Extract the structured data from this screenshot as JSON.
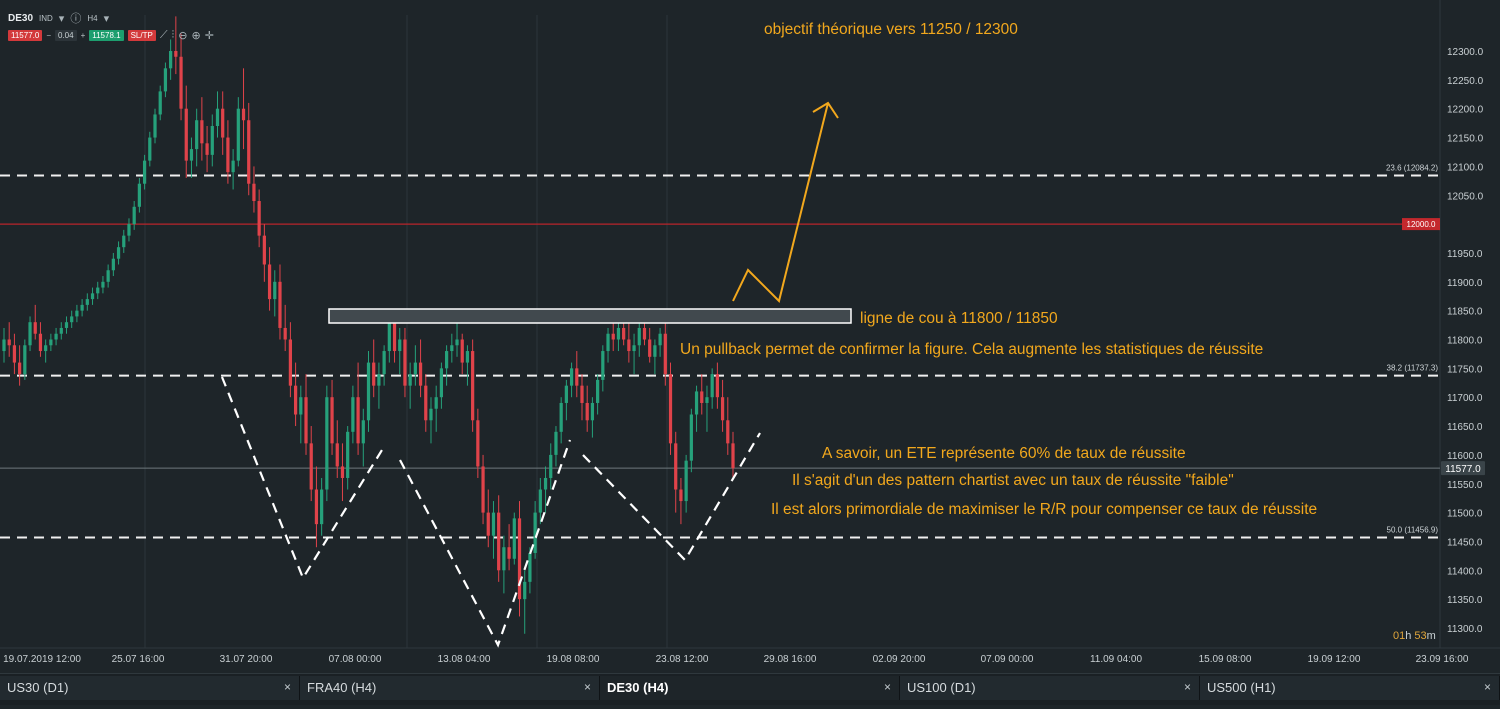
{
  "toolbar": {
    "symbol": "DE30",
    "type_badge": "IND",
    "timeframe": "H4",
    "bid_price": "11577.0",
    "minus": "−",
    "lot_size": "0.04",
    "plus": "+",
    "ask_price": "11578.1",
    "sltp_label": "SL/TP"
  },
  "chart_data": {
    "type": "candlestick",
    "instrument": "DE30 (H4)",
    "ylim": [
      11250,
      12370
    ],
    "y_ticks": [
      "12300.0",
      "12250.0",
      "12200.0",
      "12150.0",
      "12100.0",
      "12050.0",
      "12000.0",
      "11950.0",
      "11900.0",
      "11850.0",
      "11800.0",
      "11750.0",
      "11700.0",
      "11650.0",
      "11600.0",
      "11550.0",
      "11500.0",
      "11450.0",
      "11400.0",
      "11350.0",
      "11300.0"
    ],
    "x_ticks": [
      "19.07.2019 12:00",
      "25.07 16:00",
      "31.07 20:00",
      "07.08 00:00",
      "13.08 04:00",
      "19.08 08:00",
      "23.08 12:00",
      "29.08 16:00",
      "02.09 20:00",
      "07.09 00:00",
      "11.09 04:00",
      "15.09 08:00",
      "19.09 12:00",
      "23.09 16:00"
    ],
    "current_price": "11577.0",
    "level_12000": "12000.0",
    "fib_levels": [
      {
        "label": "23.6 (12084.2)",
        "value": 12084.2
      },
      {
        "label": "38.2 (11737.3)",
        "value": 11737.3
      },
      {
        "label": "50.0 (11456.9)",
        "value": 11456.9
      }
    ],
    "countdown": {
      "hours": "01",
      "h": "h",
      "minutes": "53",
      "m": "m"
    },
    "colors": {
      "up": "#26a17b",
      "down": "#e0434a",
      "annotation": "#f2a81d",
      "red_line": "#b8252a"
    },
    "annotations": [
      "objectif théorique vers 11250 / 12300",
      "ligne de cou à 11800 / 11850",
      "Un pullback permet de confirmer la figure. Cela augmente les statistiques de réussite",
      "A savoir, un ETE représente 60% de taux de réussite",
      "Il s'agit d'un des pattern chartist avec un taux de réussite \"faible\"",
      "Il est alors primordiale de maximiser le R/R pour compenser ce taux de réussite"
    ],
    "candles": [
      [
        11780,
        11820,
        11760,
        11800
      ],
      [
        11800,
        11830,
        11770,
        11790
      ],
      [
        11790,
        11810,
        11740,
        11760
      ],
      [
        11760,
        11790,
        11720,
        11740
      ],
      [
        11740,
        11800,
        11730,
        11790
      ],
      [
        11790,
        11840,
        11780,
        11830
      ],
      [
        11830,
        11860,
        11800,
        11810
      ],
      [
        11810,
        11830,
        11770,
        11780
      ],
      [
        11780,
        11800,
        11760,
        11790
      ],
      [
        11790,
        11810,
        11780,
        11800
      ],
      [
        11800,
        11820,
        11790,
        11810
      ],
      [
        11810,
        11830,
        11800,
        11820
      ],
      [
        11820,
        11840,
        11810,
        11830
      ],
      [
        11830,
        11850,
        11820,
        11840
      ],
      [
        11840,
        11860,
        11830,
        11850
      ],
      [
        11850,
        11870,
        11840,
        11860
      ],
      [
        11860,
        11880,
        11850,
        11870
      ],
      [
        11870,
        11890,
        11860,
        11880
      ],
      [
        11880,
        11900,
        11870,
        11890
      ],
      [
        11890,
        11910,
        11880,
        11900
      ],
      [
        11900,
        11930,
        11890,
        11920
      ],
      [
        11920,
        11950,
        11910,
        11940
      ],
      [
        11940,
        11970,
        11930,
        11960
      ],
      [
        11960,
        11990,
        11950,
        11980
      ],
      [
        11980,
        12010,
        11970,
        12000
      ],
      [
        12000,
        12040,
        11990,
        12030
      ],
      [
        12030,
        12080,
        12020,
        12070
      ],
      [
        12070,
        12120,
        12060,
        12110
      ],
      [
        12110,
        12160,
        12100,
        12150
      ],
      [
        12150,
        12200,
        12140,
        12190
      ],
      [
        12190,
        12240,
        12180,
        12230
      ],
      [
        12230,
        12280,
        12220,
        12270
      ],
      [
        12270,
        12320,
        12250,
        12300
      ],
      [
        12300,
        12360,
        12260,
        12290
      ],
      [
        12290,
        12330,
        12180,
        12200
      ],
      [
        12200,
        12240,
        12080,
        12110
      ],
      [
        12110,
        12150,
        12080,
        12130
      ],
      [
        12130,
        12200,
        12100,
        12180
      ],
      [
        12180,
        12220,
        12110,
        12140
      ],
      [
        12140,
        12170,
        12090,
        12120
      ],
      [
        12120,
        12190,
        12100,
        12170
      ],
      [
        12170,
        12230,
        12150,
        12200
      ],
      [
        12200,
        12230,
        12120,
        12150
      ],
      [
        12150,
        12180,
        12070,
        12090
      ],
      [
        12090,
        12130,
        12060,
        12110
      ],
      [
        12110,
        12220,
        12100,
        12200
      ],
      [
        12200,
        12270,
        12130,
        12180
      ],
      [
        12180,
        12210,
        12050,
        12070
      ],
      [
        12070,
        12100,
        12020,
        12040
      ],
      [
        12040,
        12060,
        11960,
        11980
      ],
      [
        11980,
        12000,
        11900,
        11930
      ],
      [
        11930,
        11960,
        11850,
        11870
      ],
      [
        11870,
        11920,
        11840,
        11900
      ],
      [
        11900,
        11930,
        11800,
        11820
      ],
      [
        11820,
        11860,
        11780,
        11800
      ],
      [
        11800,
        11830,
        11700,
        11720
      ],
      [
        11720,
        11760,
        11650,
        11670
      ],
      [
        11670,
        11720,
        11620,
        11700
      ],
      [
        11700,
        11740,
        11600,
        11620
      ],
      [
        11620,
        11650,
        11520,
        11540
      ],
      [
        11540,
        11580,
        11440,
        11480
      ],
      [
        11480,
        11560,
        11460,
        11540
      ],
      [
        11540,
        11720,
        11520,
        11700
      ],
      [
        11700,
        11730,
        11600,
        11620
      ],
      [
        11620,
        11660,
        11560,
        11580
      ],
      [
        11580,
        11620,
        11520,
        11560
      ],
      [
        11560,
        11650,
        11540,
        11640
      ],
      [
        11640,
        11720,
        11620,
        11700
      ],
      [
        11700,
        11760,
        11600,
        11620
      ],
      [
        11620,
        11680,
        11580,
        11660
      ],
      [
        11660,
        11780,
        11640,
        11760
      ],
      [
        11760,
        11800,
        11700,
        11720
      ],
      [
        11720,
        11760,
        11680,
        11740
      ],
      [
        11740,
        11790,
        11720,
        11780
      ],
      [
        11780,
        11850,
        11760,
        11830
      ],
      [
        11830,
        11840,
        11760,
        11780
      ],
      [
        11780,
        11820,
        11740,
        11800
      ],
      [
        11800,
        11820,
        11700,
        11720
      ],
      [
        11720,
        11760,
        11680,
        11740
      ],
      [
        11740,
        11790,
        11720,
        11760
      ],
      [
        11760,
        11800,
        11700,
        11720
      ],
      [
        11720,
        11740,
        11640,
        11660
      ],
      [
        11660,
        11700,
        11620,
        11680
      ],
      [
        11680,
        11720,
        11640,
        11700
      ],
      [
        11700,
        11760,
        11680,
        11750
      ],
      [
        11750,
        11790,
        11720,
        11780
      ],
      [
        11780,
        11810,
        11760,
        11790
      ],
      [
        11790,
        11830,
        11770,
        11800
      ],
      [
        11800,
        11810,
        11740,
        11760
      ],
      [
        11760,
        11790,
        11720,
        11780
      ],
      [
        11780,
        11800,
        11640,
        11660
      ],
      [
        11660,
        11680,
        11560,
        11580
      ],
      [
        11580,
        11600,
        11480,
        11500
      ],
      [
        11500,
        11540,
        11440,
        11460
      ],
      [
        11460,
        11520,
        11420,
        11500
      ],
      [
        11500,
        11530,
        11380,
        11400
      ],
      [
        11400,
        11460,
        11360,
        11440
      ],
      [
        11440,
        11480,
        11400,
        11420
      ],
      [
        11420,
        11500,
        11410,
        11490
      ],
      [
        11490,
        11520,
        11320,
        11350
      ],
      [
        11350,
        11400,
        11290,
        11380
      ],
      [
        11380,
        11440,
        11360,
        11430
      ],
      [
        11430,
        11520,
        11420,
        11500
      ],
      [
        11500,
        11560,
        11480,
        11540
      ],
      [
        11540,
        11580,
        11500,
        11560
      ],
      [
        11560,
        11620,
        11540,
        11600
      ],
      [
        11600,
        11650,
        11580,
        11640
      ],
      [
        11640,
        11700,
        11620,
        11690
      ],
      [
        11690,
        11730,
        11660,
        11720
      ],
      [
        11720,
        11760,
        11700,
        11750
      ],
      [
        11750,
        11780,
        11700,
        11720
      ],
      [
        11720,
        11740,
        11660,
        11690
      ],
      [
        11690,
        11720,
        11640,
        11660
      ],
      [
        11660,
        11700,
        11630,
        11690
      ],
      [
        11690,
        11740,
        11670,
        11730
      ],
      [
        11730,
        11790,
        11710,
        11780
      ],
      [
        11780,
        11820,
        11760,
        11810
      ],
      [
        11810,
        11830,
        11780,
        11800
      ],
      [
        11800,
        11840,
        11780,
        11820
      ],
      [
        11820,
        11850,
        11790,
        11800
      ],
      [
        11800,
        11830,
        11760,
        11780
      ],
      [
        11780,
        11810,
        11740,
        11790
      ],
      [
        11790,
        11830,
        11770,
        11820
      ],
      [
        11820,
        11850,
        11790,
        11800
      ],
      [
        11800,
        11820,
        11760,
        11770
      ],
      [
        11770,
        11800,
        11740,
        11790
      ],
      [
        11790,
        11820,
        11770,
        11810
      ],
      [
        11810,
        11830,
        11720,
        11740
      ],
      [
        11740,
        11760,
        11600,
        11620
      ],
      [
        11620,
        11640,
        11500,
        11540
      ],
      [
        11540,
        11560,
        11480,
        11520
      ],
      [
        11520,
        11600,
        11500,
        11590
      ],
      [
        11590,
        11680,
        11570,
        11670
      ],
      [
        11670,
        11720,
        11640,
        11710
      ],
      [
        11710,
        11740,
        11670,
        11690
      ],
      [
        11690,
        11720,
        11640,
        11700
      ],
      [
        11700,
        11750,
        11680,
        11740
      ],
      [
        11740,
        11760,
        11680,
        11700
      ],
      [
        11700,
        11730,
        11640,
        11660
      ],
      [
        11660,
        11700,
        11600,
        11620
      ],
      [
        11620,
        11640,
        11560,
        11577
      ]
    ]
  },
  "tabs": [
    {
      "label": "US30 (D1)",
      "close": "×"
    },
    {
      "label": "FRA40 (H4)",
      "close": "×"
    },
    {
      "label": "DE30 (H4)",
      "close": "×"
    },
    {
      "label": "US100 (D1)",
      "close": "×"
    },
    {
      "label": "US500 (H1)",
      "close": "×"
    }
  ]
}
